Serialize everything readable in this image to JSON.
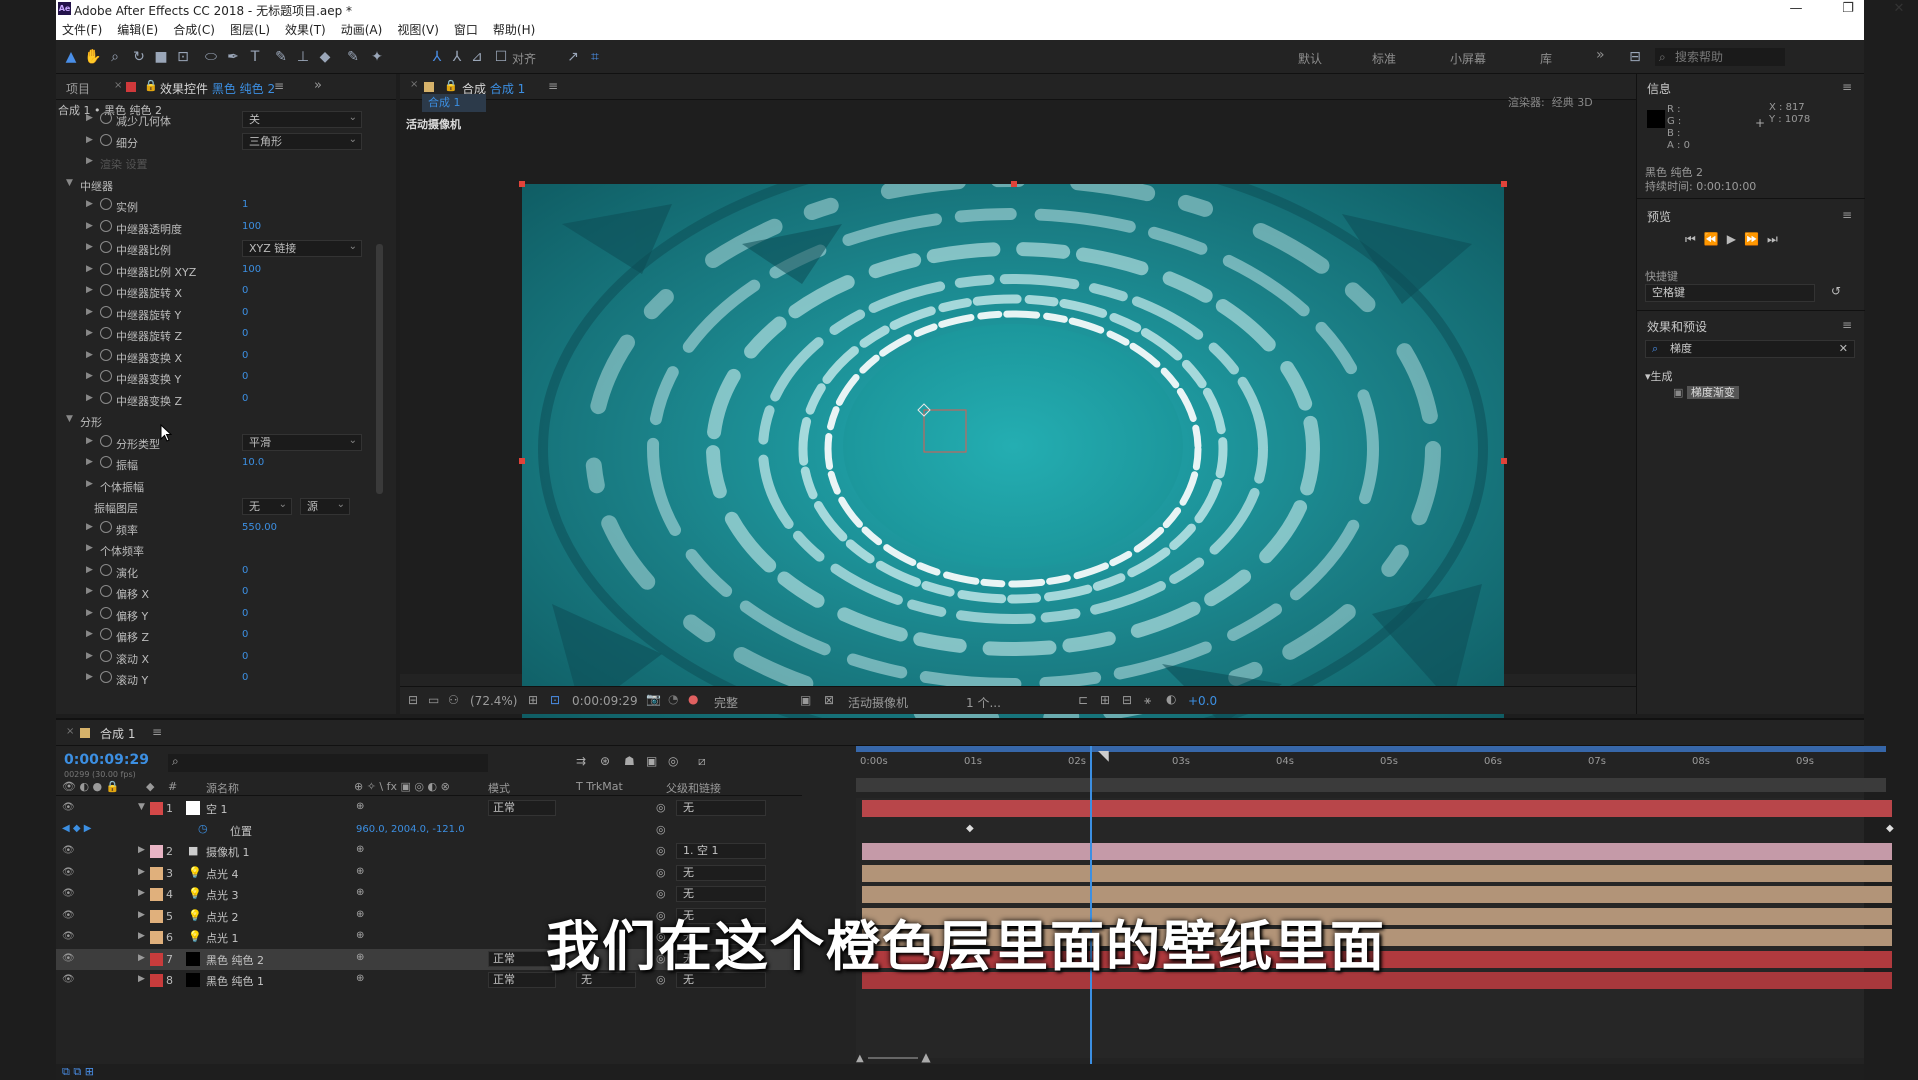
{
  "app": {
    "title": "Adobe After Effects CC 2018 - 无标题项目.aep *",
    "icon": "Ae",
    "menu": [
      "文件(F)",
      "编辑(E)",
      "合成(C)",
      "图层(L)",
      "效果(T)",
      "动画(A)",
      "视图(V)",
      "窗口",
      "帮助(H)"
    ],
    "window_controls": [
      "—",
      "❐",
      "✕"
    ]
  },
  "toolbar": {
    "align_label": "对齐",
    "workspaces": [
      "默认",
      "标准",
      "小屏幕",
      "库"
    ],
    "more": "»",
    "search_placeholder": "搜索帮助"
  },
  "effects_panel": {
    "tab_project": "项目",
    "tab_effects_prefix": "效果控件",
    "tab_effects_layer": "黑色 纯色 2",
    "breadcrumb": "合成 1 • 黑色 纯色 2",
    "rows": [
      {
        "type": "prop",
        "label": "减少几何体",
        "dropdown": "关"
      },
      {
        "type": "prop",
        "label": "细分",
        "dropdown": "三角形"
      },
      {
        "type": "group-collapsed",
        "label": "渲染 设置"
      },
      {
        "type": "group",
        "label": "中继器"
      },
      {
        "type": "prop",
        "label": "实例",
        "value": "1"
      },
      {
        "type": "prop",
        "label": "中继器透明度",
        "value": "100"
      },
      {
        "type": "prop",
        "label": "中继器比例",
        "dropdown": "XYZ 链接"
      },
      {
        "type": "prop",
        "label": "中继器比例 XYZ",
        "value": "100"
      },
      {
        "type": "prop",
        "label": "中继器旋转 X",
        "value": "0"
      },
      {
        "type": "prop",
        "label": "中继器旋转 Y",
        "value": "0"
      },
      {
        "type": "prop",
        "label": "中继器旋转 Z",
        "value": "0"
      },
      {
        "type": "prop",
        "label": "中继器变换 X",
        "value": "0"
      },
      {
        "type": "prop",
        "label": "中继器变换 Y",
        "value": "0"
      },
      {
        "type": "prop",
        "label": "中继器变换 Z",
        "value": "0"
      },
      {
        "type": "group",
        "label": "分形"
      },
      {
        "type": "prop",
        "label": "分形类型",
        "dropdown": "平滑"
      },
      {
        "type": "prop",
        "label": "振幅",
        "value": "10.0"
      },
      {
        "type": "sub",
        "label": "个体振幅"
      },
      {
        "type": "layerprop",
        "label": "振幅图层",
        "dropdown": "无",
        "dropdown2": "源"
      },
      {
        "type": "prop",
        "label": "频率",
        "value": "550.00"
      },
      {
        "type": "sub",
        "label": "个体频率"
      },
      {
        "type": "prop",
        "label": "演化",
        "value": "0"
      },
      {
        "type": "prop",
        "label": "偏移 X",
        "value": "0"
      },
      {
        "type": "prop",
        "label": "偏移 Y",
        "value": "0"
      },
      {
        "type": "prop",
        "label": "偏移 Z",
        "value": "0"
      },
      {
        "type": "prop",
        "label": "滚动 X",
        "value": "0"
      },
      {
        "type": "prop",
        "label": "滚动 Y",
        "value": "0"
      }
    ]
  },
  "comp_panel": {
    "tab_prefix": "合成",
    "tab_name": "合成 1",
    "subtab": "合成 1",
    "camera_label": "活动摄像机",
    "renderer_label": "渲染器:",
    "renderer_value": "经典 3D",
    "zoom": "(72.4%)",
    "timecode": "0:00:09:29",
    "quality": "完整",
    "view": "活动摄像机",
    "views_count": "1 个...",
    "exposure": "+0.0"
  },
  "info_panel": {
    "title": "信息",
    "r": "R :",
    "g": "G :",
    "b": "B :",
    "a": "A : 0",
    "x": "X : 817",
    "y": "Y : 1078",
    "layer_name": "黑色 纯色 2",
    "duration": "持续时间: 0:00:10:00"
  },
  "preview_panel": {
    "title": "预览",
    "shortcut_label": "快捷键",
    "shortcut_value": "空格键"
  },
  "effects_presets": {
    "title": "效果和预设",
    "search_value": "梯度",
    "category": "生成",
    "item": "梯度渐变"
  },
  "timeline": {
    "tab": "合成 1",
    "timecode": "0:00:09:29",
    "frame_info": "00299 (30.00 fps)",
    "col_source": "源名称",
    "col_mode": "模式",
    "col_trkmat": "T TrkMat",
    "col_parent": "父级和链接",
    "ruler": [
      "0:00s",
      "01s",
      "02s",
      "03s",
      "04s",
      "05s",
      "06s",
      "07s",
      "08s",
      "09s"
    ],
    "layers": [
      {
        "num": "1",
        "name": "空 1",
        "color": "#d44848",
        "thumb": "#ffffff",
        "mode": "正常",
        "parent": "无",
        "bar": "#b8464a",
        "expanded": true
      },
      {
        "num": "",
        "name": "位置",
        "value": "960.0, 2004.0, -121.0",
        "prop": true
      },
      {
        "num": "2",
        "name": "摄像机 1",
        "color": "#e8b4c4",
        "icon": "camera",
        "parent": "1. 空 1",
        "bar": "#c59aa8"
      },
      {
        "num": "3",
        "name": "点光 4",
        "color": "#e0b07c",
        "icon": "light",
        "parent": "无",
        "bar": "#b29478"
      },
      {
        "num": "4",
        "name": "点光 3",
        "color": "#e0b07c",
        "icon": "light",
        "parent": "无",
        "bar": "#b29478"
      },
      {
        "num": "5",
        "name": "点光 2",
        "color": "#e0b07c",
        "icon": "light",
        "parent": "无",
        "bar": "#b29478"
      },
      {
        "num": "6",
        "name": "点光 1",
        "color": "#e0b07c",
        "icon": "light",
        "parent": "无",
        "bar": "#b29478"
      },
      {
        "num": "7",
        "name": "黑色 纯色 2",
        "color": "#c83c3c",
        "thumb": "#000000",
        "mode": "正常",
        "parent": "无",
        "bar": "#b03a3e",
        "selected": true
      },
      {
        "num": "8",
        "name": "黑色 纯色 1",
        "color": "#c83c3c",
        "thumb": "#000000",
        "mode": "正常",
        "trkmat": "无",
        "parent": "无",
        "bar": "#a8383c"
      }
    ]
  },
  "subtitle": "我们在这个橙色层里面的壁纸里面",
  "colors": {
    "accent_blue": "#3c8fe2",
    "accent_orange": "#d88b3a",
    "teal_render": "#1f8f94",
    "panel_bg": "#232323"
  }
}
